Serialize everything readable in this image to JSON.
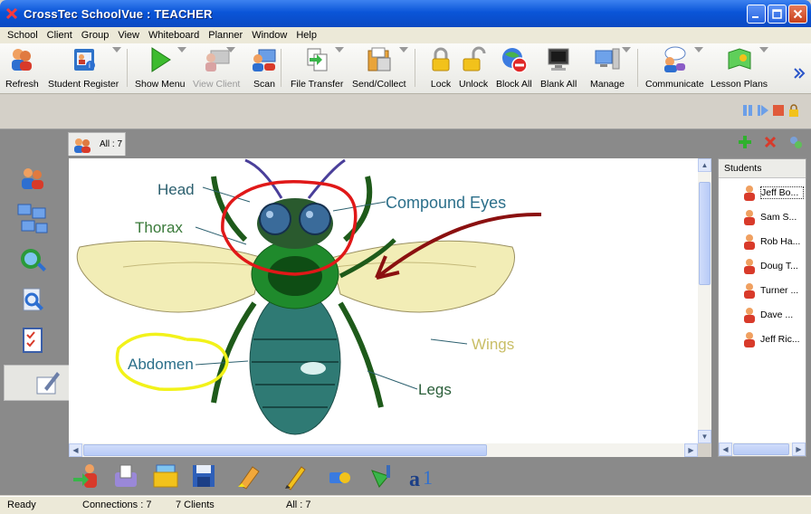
{
  "window": {
    "title": "CrossTec SchoolVue : TEACHER"
  },
  "menu": [
    "School",
    "Client",
    "Group",
    "View",
    "Whiteboard",
    "Planner",
    "Window",
    "Help"
  ],
  "toolbar": [
    {
      "label": "Refresh",
      "icon": "refresh-icon",
      "disabled": false
    },
    {
      "label": "Student Register",
      "icon": "student-register-icon",
      "disabled": false
    },
    {
      "label": "Show Menu",
      "icon": "play-icon",
      "disabled": false
    },
    {
      "label": "View Client",
      "icon": "view-client-icon",
      "disabled": true
    },
    {
      "label": "Scan",
      "icon": "scan-icon",
      "disabled": false
    },
    {
      "label": "File Transfer",
      "icon": "file-transfer-icon",
      "disabled": false
    },
    {
      "label": "Send/Collect",
      "icon": "send-collect-icon",
      "disabled": false
    },
    {
      "label": "Lock",
      "icon": "lock-icon",
      "disabled": false
    },
    {
      "label": "Unlock",
      "icon": "unlock-icon",
      "disabled": false
    },
    {
      "label": "Block All",
      "icon": "block-all-icon",
      "disabled": false
    },
    {
      "label": "Blank All",
      "icon": "monitor-icon",
      "disabled": false
    },
    {
      "label": "Manage",
      "icon": "manage-icon",
      "disabled": false
    },
    {
      "label": "Communicate",
      "icon": "communicate-icon",
      "disabled": false
    },
    {
      "label": "Lesson Plans",
      "icon": "lesson-plans-icon",
      "disabled": false
    }
  ],
  "tab": {
    "label": "All : 7"
  },
  "students": {
    "header": "Students",
    "items": [
      "Jeff Bo...",
      "Sam S...",
      "Rob Ha...",
      "Doug T...",
      "Turner ...",
      "Dave ...",
      "Jeff Ric..."
    ]
  },
  "whiteboard": {
    "labels": {
      "head": "Head",
      "thorax": "Thorax",
      "compound_eyes": "Compound Eyes",
      "abdomen": "Abdomen",
      "wings": "Wings",
      "legs": "Legs"
    }
  },
  "statusbar": {
    "status": "Ready",
    "connections": "Connections : 7",
    "clients": "7 Clients",
    "all": "All : 7"
  },
  "colors": {
    "title_bar": "#0a55d8",
    "annotation_red": "#e01818",
    "annotation_yellow": "#f2f21a",
    "annotation_darkred": "#8b1010",
    "label_text": "#2b5f6e"
  }
}
